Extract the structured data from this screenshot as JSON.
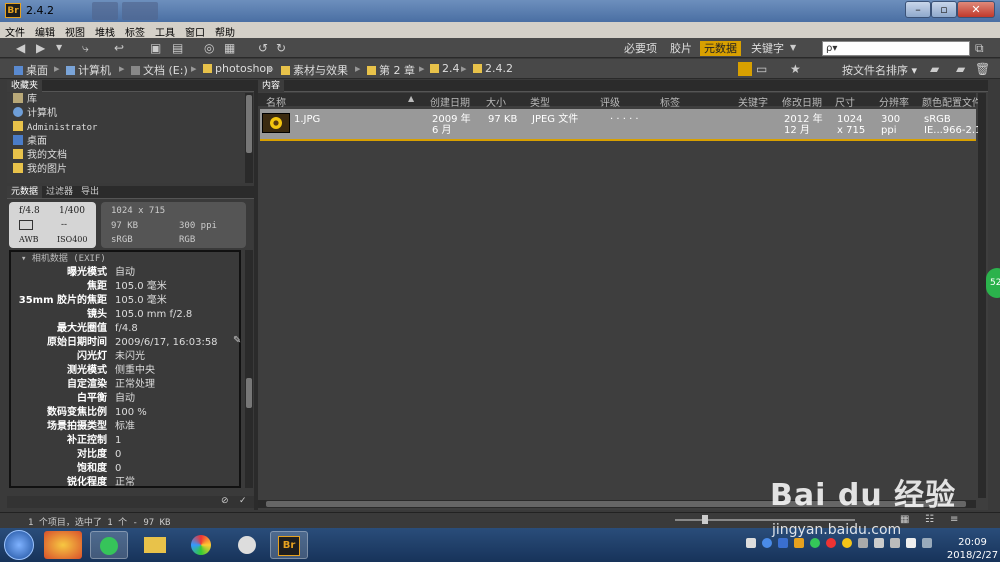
{
  "window": {
    "title": "2.4.2",
    "app_icon": "Br"
  },
  "menu": [
    "文件",
    "编辑",
    "视图",
    "堆栈",
    "标签",
    "工具",
    "窗口",
    "帮助"
  ],
  "workspaces": [
    {
      "label": "必要项",
      "active": false
    },
    {
      "label": "胶片",
      "active": false
    },
    {
      "label": "元数据",
      "active": true
    },
    {
      "label": "关键字",
      "active": false
    }
  ],
  "search": {
    "placeholder": "ρ▾"
  },
  "breadcrumb": [
    "桌面",
    "计算机",
    "文档 (E:)",
    "photoshop",
    "素材与效果",
    "第 2 章",
    "2.4",
    "2.4.2"
  ],
  "sort_label": "按文件名排序",
  "favorites": {
    "tab": "收藏夹",
    "items": [
      "库",
      "计算机",
      "Administrator",
      "桌面",
      "我的文档",
      "我的图片"
    ]
  },
  "meta_tabs": [
    "元数据",
    "过滤器",
    "导出"
  ],
  "camera": {
    "aperture": "f/4.8",
    "shutter": "1/400",
    "exposure": "--",
    "wb": "AWB",
    "iso": "ISO400"
  },
  "fileinfo": {
    "dims": "1024 x 715",
    "size": "97 KB",
    "res": "300 ppi",
    "profile": "sRGB",
    "mode": "RGB"
  },
  "exif": {
    "header": "相机数据 (EXIF)",
    "rows": [
      {
        "k": "曝光模式",
        "v": "自动"
      },
      {
        "k": "焦距",
        "v": "105.0 毫米"
      },
      {
        "k": "35mm 胶片的焦距",
        "v": "105.0 毫米"
      },
      {
        "k": "镜头",
        "v": "105.0 mm f/2.8"
      },
      {
        "k": "最大光圈值",
        "v": "f/4.8"
      },
      {
        "k": "原始日期时间",
        "v": "2009/6/17, 16:03:58"
      },
      {
        "k": "闪光灯",
        "v": "未闪光"
      },
      {
        "k": "测光模式",
        "v": "侧重中央"
      },
      {
        "k": "自定渲染",
        "v": "正常处理"
      },
      {
        "k": "白平衡",
        "v": "自动"
      },
      {
        "k": "数码变焦比例",
        "v": "100 %"
      },
      {
        "k": "场景拍摄类型",
        "v": "标准"
      },
      {
        "k": "补正控制",
        "v": "1"
      },
      {
        "k": "对比度",
        "v": "0"
      },
      {
        "k": "饱和度",
        "v": "0"
      },
      {
        "k": "锐化程度",
        "v": "正常"
      }
    ]
  },
  "content": {
    "tab": "内容",
    "columns": [
      "名称",
      "创建日期",
      "大小",
      "类型",
      "评级",
      "标签",
      "关键字",
      "修改日期",
      "尺寸",
      "分辨率",
      "颜色配置文件"
    ],
    "row": {
      "name": "1.JPG",
      "created_1": "2009 年",
      "created_2": "6 月",
      "size": "97 KB",
      "type": "JPEG 文件",
      "rating": "· · · · ·",
      "modified_1": "2012 年",
      "modified_2": "12 月",
      "dims_1": "1024",
      "dims_2": "x 715",
      "res_1": "300",
      "res_2": "ppi",
      "profile_1": "sRGB",
      "profile_2": "IE...966-2.1"
    }
  },
  "status": "1 个项目，选中了 1 个 - 97 KB",
  "side_badge": "52",
  "clock": {
    "time": "20:09",
    "date": "2018/2/27"
  },
  "watermark": {
    "brand": "Bai du 经验",
    "url": "jingyan.baidu.com"
  }
}
